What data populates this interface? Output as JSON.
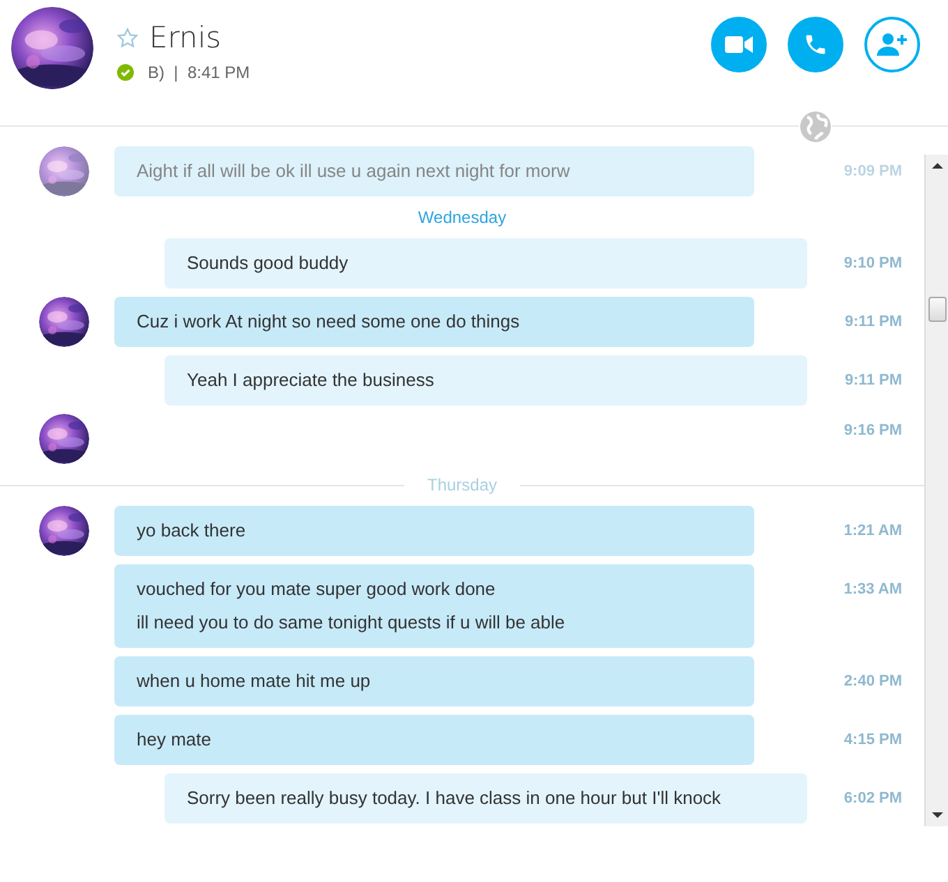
{
  "contact": {
    "name": "Ernis",
    "favorite": false,
    "online": true,
    "status_text": "B)  |  8:41 PM"
  },
  "items": [
    {
      "kind": "incoming",
      "avatar": true,
      "faded": true,
      "lines": [
        "Aight if all will be ok ill use u again next night for morw"
      ],
      "time": "9:09 PM"
    },
    {
      "kind": "day",
      "label": "Wednesday",
      "highlighted": true
    },
    {
      "kind": "outgoing",
      "avatar": false,
      "faded": false,
      "lines": [
        "Sounds good buddy"
      ],
      "time": "9:10 PM"
    },
    {
      "kind": "incoming",
      "avatar": true,
      "faded": false,
      "lines": [
        "Cuz i work At night so need some one do things"
      ],
      "time": "9:11 PM"
    },
    {
      "kind": "outgoing",
      "avatar": false,
      "faded": false,
      "lines": [
        "Yeah I appreciate the business"
      ],
      "time": "9:11 PM"
    },
    {
      "kind": "avatar_only",
      "avatar": true,
      "faded": false,
      "time": "9:16 PM"
    },
    {
      "kind": "day",
      "label": "Thursday",
      "highlighted": false
    },
    {
      "kind": "incoming",
      "avatar": true,
      "faded": false,
      "lines": [
        "yo back there"
      ],
      "time": "1:21 AM"
    },
    {
      "kind": "incoming",
      "avatar": false,
      "faded": false,
      "lines": [
        "vouched for you mate super good work done",
        "ill need you to do same tonight quests if u will be able"
      ],
      "time": "1:33 AM"
    },
    {
      "kind": "incoming",
      "avatar": false,
      "faded": false,
      "lines": [
        "when u home mate hit me up"
      ],
      "time": "2:40 PM"
    },
    {
      "kind": "incoming",
      "avatar": false,
      "faded": false,
      "lines": [
        "hey mate"
      ],
      "time": "4:15 PM"
    },
    {
      "kind": "outgoing",
      "avatar": false,
      "faded": false,
      "lines": [
        "Sorry been really busy today. I have class in one hour but I'll knock"
      ],
      "time": "6:02 PM"
    }
  ]
}
